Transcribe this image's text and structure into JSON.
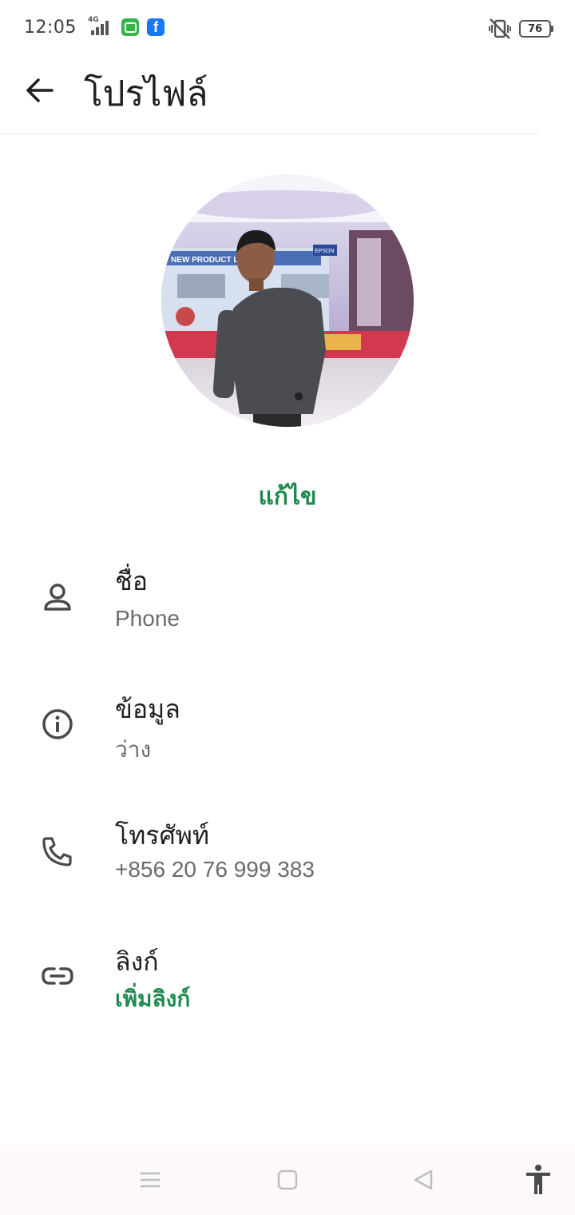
{
  "status_bar": {
    "time": "12:05",
    "network_label": "4G",
    "battery_level": "76",
    "icons": [
      "signal-icon",
      "message-app-icon",
      "facebook-icon",
      "vibrate-icon",
      "battery-icon"
    ]
  },
  "header": {
    "title": "โปรไฟล์",
    "back_icon": "arrow-back-icon"
  },
  "profile": {
    "edit_label": "แก้ไข",
    "photo_banner_text": "NEW PRODUCT LAUN",
    "photo_brand_text": "EPSON"
  },
  "rows": [
    {
      "icon": "person-icon",
      "title": "ชื่อ",
      "value": "Phone"
    },
    {
      "icon": "info-icon",
      "title": "ข้อมูล",
      "value": "ว่าง"
    },
    {
      "icon": "phone-icon",
      "title": "โทรศัพท์",
      "value": "+856 20 76 999 383"
    },
    {
      "icon": "link-icon",
      "title": "ลิงก์",
      "value": "เพิ่มลิงก์"
    }
  ],
  "nav_bar": {
    "buttons": [
      "menu-icon",
      "home-icon",
      "back-icon",
      "accessibility-icon"
    ]
  },
  "colors": {
    "accent": "#1f8a50",
    "text_primary": "#1f1f1f",
    "text_secondary": "#6b6b6b",
    "icon": "#4a4a4a",
    "nav_bar_bg": "#fcf8fc"
  }
}
